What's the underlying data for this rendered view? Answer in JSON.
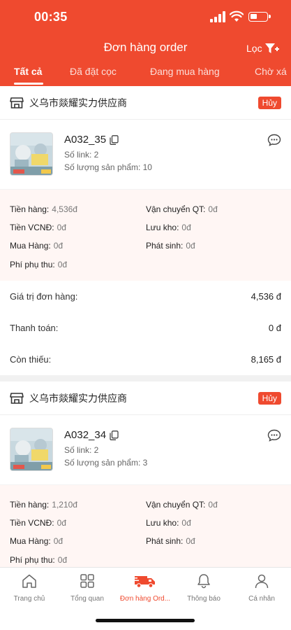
{
  "status_bar": {
    "time": "00:35"
  },
  "header": {
    "title": "Đơn hàng order",
    "filter_label": "Lọc"
  },
  "tabs": [
    {
      "label": "Tất cả",
      "active": true
    },
    {
      "label": "Đã đặt cọc"
    },
    {
      "label": "Đang mua hàng"
    },
    {
      "label": "Chờ xá"
    }
  ],
  "orders": [
    {
      "shop_name": "义乌市燚耀实力供应商",
      "status_badge": "Hủy",
      "code": "A032_35",
      "links": "Số link: 2",
      "quantity": "Số lượng sản phẩm: 10",
      "costs": {
        "tien_hang_label": "Tiền hàng:",
        "tien_hang": "4,536đ",
        "van_chuyen_label": "Vận chuyển QT:",
        "van_chuyen": "0đ",
        "tien_vcnd_label": "Tiền VCNĐ:",
        "tien_vcnd": "0đ",
        "luu_kho_label": "Lưu kho:",
        "luu_kho": "0đ",
        "mua_hang_label": "Mua Hàng:",
        "mua_hang": "0đ",
        "phat_sinh_label": "Phát sinh:",
        "phat_sinh": "0đ",
        "phi_phu_thu_label": "Phí phụ thu:",
        "phi_phu_thu": "0đ"
      },
      "totals": {
        "gia_tri_label": "Giá trị đơn hàng:",
        "gia_tri": "4,536 đ",
        "thanh_toan_label": "Thanh toán:",
        "thanh_toan": "0 đ",
        "con_thieu_label": "Còn thiếu:",
        "con_thieu": "8,165 đ"
      }
    },
    {
      "shop_name": "义乌市燚耀实力供应商",
      "status_badge": "Hủy",
      "code": "A032_34",
      "links": "Số link: 2",
      "quantity": "Số lượng sản phẩm: 3",
      "costs": {
        "tien_hang_label": "Tiền hàng:",
        "tien_hang": "1,210đ",
        "van_chuyen_label": "Vận chuyển QT:",
        "van_chuyen": "0đ",
        "tien_vcnd_label": "Tiền VCNĐ:",
        "tien_vcnd": "0đ",
        "luu_kho_label": "Lưu kho:",
        "luu_kho": "0đ",
        "mua_hang_label": "Mua Hàng:",
        "mua_hang": "0đ",
        "phat_sinh_label": "Phát sinh:",
        "phat_sinh": "0đ",
        "phi_phu_thu_label": "Phí phụ thu:",
        "phi_phu_thu": "0đ"
      }
    }
  ],
  "bottom_nav": [
    {
      "label": "Trang chủ",
      "icon": "home-icon"
    },
    {
      "label": "Tổng quan",
      "icon": "grid-icon"
    },
    {
      "label": "Đơn hàng Ord...",
      "icon": "truck-icon",
      "active": true
    },
    {
      "label": "Thông báo",
      "icon": "bell-icon"
    },
    {
      "label": "Cá nhân",
      "icon": "person-icon"
    }
  ],
  "colors": {
    "accent": "#ef4a2f",
    "cost_bg": "#fff6f4"
  }
}
